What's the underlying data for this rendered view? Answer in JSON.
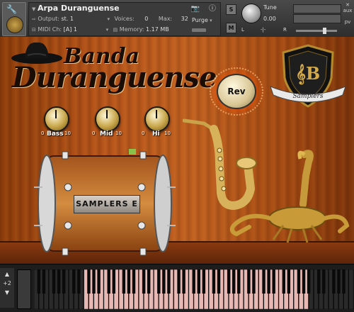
{
  "header": {
    "instrument_title": "Arpa Duranguense",
    "output_label": "Output:",
    "output_value": "st. 1",
    "voices_label": "Voices:",
    "voices_value": "0",
    "max_label": "Max:",
    "max_value": "32",
    "purge_label": "Purge",
    "midi_label": "MIDI Ch:",
    "midi_value": "[A] 1",
    "memory_label": "Memory:",
    "memory_value": "1.17 MB",
    "tune_label": "Tune",
    "tune_value": "0.00",
    "solo_label": "S",
    "mute_label": "M",
    "pan_left": "L",
    "pan_right": "R",
    "pan_mid": "-|-",
    "aux_label": "aux",
    "pv_label": "pv"
  },
  "panel": {
    "brand_line1": "Banda",
    "brand_line2": "Duranguense",
    "bass_label": "Bass",
    "mid_label": "Mid",
    "hi_label": "Hi",
    "knob_min": "0",
    "knob_max": "10",
    "rev_label": "Rev",
    "drum_label": "SAMPLERS E",
    "shield_text": "Samplers"
  },
  "keyboard": {
    "octave_label": "+2"
  },
  "colors": {
    "wood": "#b8551a",
    "header": "#3b3b3b",
    "rev_glow": "#ff5000",
    "key_pink": "#e8b9b4"
  }
}
